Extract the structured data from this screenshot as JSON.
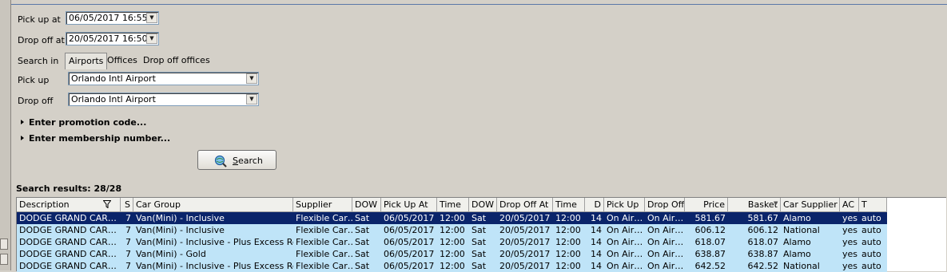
{
  "form": {
    "pickup_at_label": "Pick up at",
    "pickup_at_value": "06/05/2017 16:55",
    "dropoff_at_label": "Drop off at",
    "dropoff_at_value": "20/05/2017 16:50",
    "search_in_label": "Search in",
    "tabs": [
      "Airports",
      "Offices",
      "Drop off offices"
    ],
    "pickup_label": "Pick up",
    "pickup_value": "Orlando Intl Airport",
    "dropoff_label": "Drop off",
    "dropoff_value": "Orlando Intl Airport",
    "promo_label": "Enter promotion code...",
    "membership_label": "Enter membership number...",
    "search_button": "Search"
  },
  "results": {
    "title": "Search results: 28/28",
    "columns": [
      "Description",
      "S",
      "Car Group",
      "Supplier",
      "DOW",
      "Pick Up At",
      "Time",
      "DOW",
      "Drop Off At",
      "Time",
      "D",
      "Pick Up",
      "Drop Off",
      "Price",
      "Basket",
      "Car Supplier",
      "AC",
      "T"
    ],
    "rows": [
      [
        "DODGE GRAND CAR…",
        "7",
        "Van(Mini) - Inclusive",
        "Flexible Car…",
        "Sat",
        "06/05/2017",
        "12:00",
        "Sat",
        "20/05/2017",
        "12:00",
        "14",
        "On Air…",
        "On Air…",
        "581.67",
        "581.67",
        "Alamo",
        "yes",
        "auto"
      ],
      [
        "DODGE GRAND CAR…",
        "7",
        "Van(Mini) - Inclusive",
        "Flexible Car…",
        "Sat",
        "06/05/2017",
        "12:00",
        "Sat",
        "20/05/2017",
        "12:00",
        "14",
        "On Air…",
        "On Air…",
        "606.12",
        "606.12",
        "National",
        "yes",
        "auto"
      ],
      [
        "DODGE GRAND CAR…",
        "7",
        "Van(Mini) - Inclusive - Plus Excess Ref…",
        "Flexible Car…",
        "Sat",
        "06/05/2017",
        "12:00",
        "Sat",
        "20/05/2017",
        "12:00",
        "14",
        "On Air…",
        "On Air…",
        "618.07",
        "618.07",
        "Alamo",
        "yes",
        "auto"
      ],
      [
        "DODGE GRAND CAR…",
        "7",
        "Van(Mini) - Gold",
        "Flexible Car…",
        "Sat",
        "06/05/2017",
        "12:00",
        "Sat",
        "20/05/2017",
        "12:00",
        "14",
        "On Air…",
        "On Air…",
        "638.87",
        "638.87",
        "Alamo",
        "yes",
        "auto"
      ],
      [
        "DODGE GRAND CAR…",
        "7",
        "Van(Mini) - Inclusive - Plus Excess Ref…",
        "Flexible Car…",
        "Sat",
        "06/05/2017",
        "12:00",
        "Sat",
        "20/05/2017",
        "12:00",
        "14",
        "On Air…",
        "On Air…",
        "642.52",
        "642.52",
        "National",
        "yes",
        "auto"
      ]
    ]
  },
  "colors": {
    "selected_row": "#0a246a",
    "row_bg": "#bfe4f8",
    "panel_bg": "#d4d0c8"
  },
  "icons": {
    "search_button_icon": "magnifier-globe-icon",
    "filter_icon": "filter-icon",
    "sort_icon": "sort-desc-icon"
  }
}
